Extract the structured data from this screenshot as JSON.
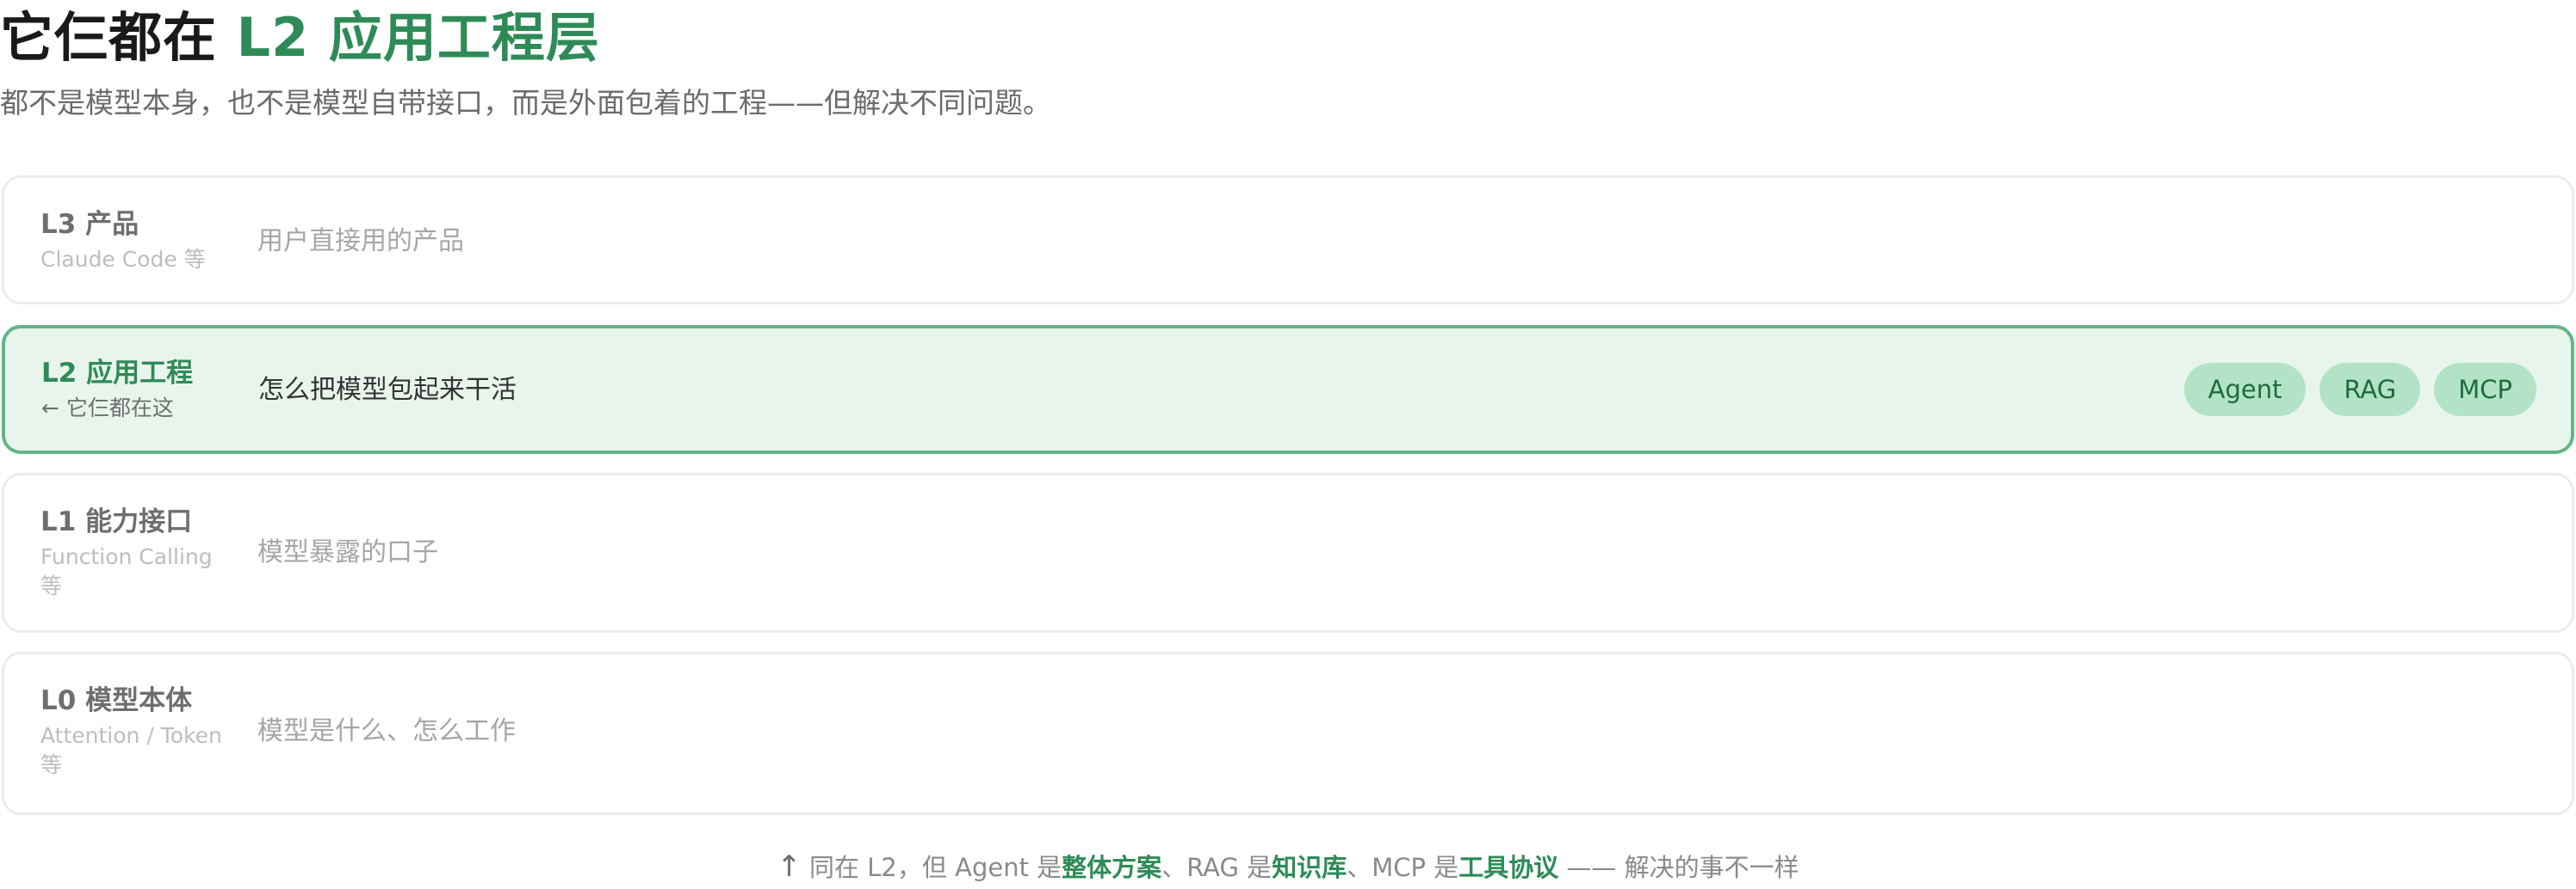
{
  "header": {
    "title_prefix": "它仨都在 ",
    "title_accent": "L2 应用工程层",
    "subtitle": "都不是模型本身，也不是模型自带接口，而是外面包着的工程——但解决不同问题。"
  },
  "layers": [
    {
      "name": "L3 产品",
      "note": "Claude Code 等",
      "desc": "用户直接用的产品"
    },
    {
      "name": "L2 应用工程",
      "note": "← 它仨都在这",
      "desc": "怎么把模型包起来干活",
      "tags": [
        "Agent",
        "RAG",
        "MCP"
      ]
    },
    {
      "name": "L1 能力接口",
      "note": "Function Calling 等",
      "desc": "模型暴露的口子"
    },
    {
      "name": "L0 模型本体",
      "note": "Attention / Token 等",
      "desc": "模型是什么、怎么工作"
    }
  ],
  "footer": {
    "arrow": "↑",
    "t1": " 同在 L2，但 Agent 是",
    "h1": "整体方案",
    "t2": "、RAG 是",
    "h2": "知识库",
    "t3": "、MCP 是",
    "h3": "工具协议",
    "t4": " —— 解决的事不一样"
  },
  "colors": {
    "accent": "#2e8b57",
    "active_bg": "#e8f5ec",
    "active_border": "#62b585",
    "tag_bg": "#b3e3c6"
  }
}
